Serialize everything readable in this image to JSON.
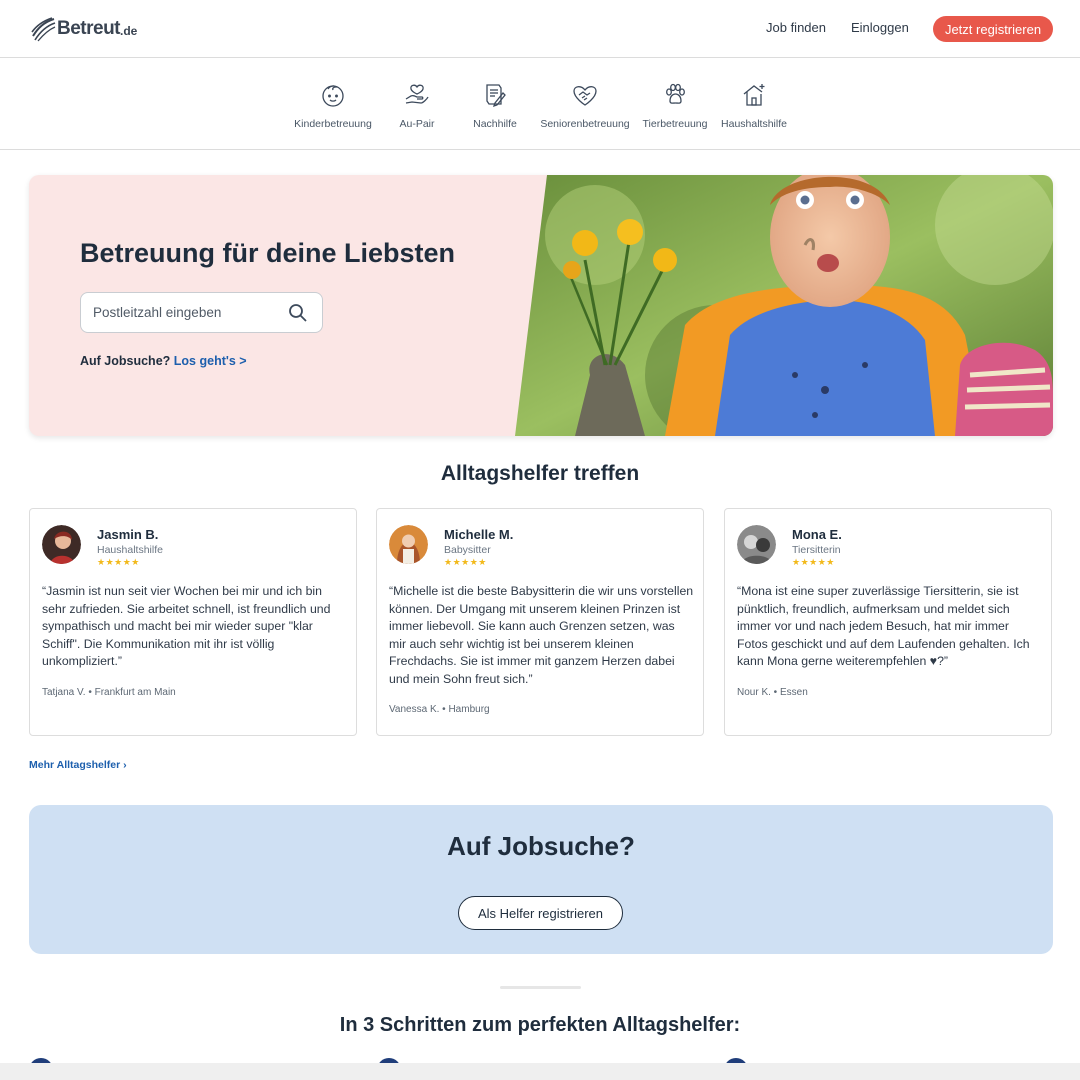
{
  "header": {
    "logo_text": "Betreut",
    "logo_tld": ".de",
    "nav": {
      "job_finden": "Job finden",
      "einloggen": "Einloggen",
      "register": "Jetzt registrieren"
    }
  },
  "categories": [
    {
      "label": "Kinderbetreuung",
      "icon": "child-face-icon"
    },
    {
      "label": "Au-Pair",
      "icon": "hand-heart-icon"
    },
    {
      "label": "Nachhilfe",
      "icon": "notebook-pencil-icon"
    },
    {
      "label": "Seniorenbetreuung",
      "icon": "handshake-heart-icon"
    },
    {
      "label": "Tierbetreuung",
      "icon": "paw-icon"
    },
    {
      "label": "Haushaltshilfe",
      "icon": "house-sparkle-icon"
    }
  ],
  "hero": {
    "title": "Betreuung für deine Liebsten",
    "search_placeholder": "Postleitzahl eingeben",
    "job_prompt": "Auf Jobsuche?",
    "job_link": "Los geht's >"
  },
  "helpers_section": {
    "title": "Alltagshelfer treffen",
    "cards": [
      {
        "name": "Jasmin B.",
        "role": "Haushaltshilfe",
        "stars": "★★★★★",
        "quote": "“Jasmin ist nun seit vier Wochen bei mir und ich bin sehr zufrieden. Sie arbeitet schnell, ist freundlich und sympathisch und macht bei mir wieder super \"klar Schiff\". Die Kommunikation mit ihr ist völlig unkompliziert.”",
        "author": "Tatjana V. • Frankfurt am Main"
      },
      {
        "name": "Michelle M.",
        "role": "Babysitter",
        "stars": "★★★★★",
        "quote": "“Michelle ist die beste Babysitterin die wir uns vorstellen können. Der Umgang mit unserem kleinen Prinzen ist immer liebevoll. Sie kann auch Grenzen setzen, was mir auch sehr wichtig ist bei unserem kleinen Frechdachs. Sie ist immer mit ganzem Herzen dabei und mein Sohn freut sich.”",
        "author": "Vanessa K. • Hamburg"
      },
      {
        "name": "Mona E.",
        "role": "Tiersitterin",
        "stars": "★★★★★",
        "quote": "“Mona ist eine super zuverlässige Tiersitterin, sie ist pünktlich, freundlich, aufmerksam und meldet sich immer vor und nach jedem Besuch, hat mir immer Fotos geschickt und auf dem Laufenden gehalten. Ich kann Mona gerne weiterempfehlen ♥?”",
        "author": "Nour K. • Essen"
      }
    ],
    "more_link": "Mehr Alltagshelfer ›"
  },
  "job_banner": {
    "title": "Auf Jobsuche?",
    "button": "Als Helfer registrieren"
  },
  "steps_section": {
    "title": "In 3 Schritten zum perfekten Alltagshelfer:"
  },
  "colors": {
    "accent": "#e8584b",
    "link": "#1d5fad",
    "hero_bg": "#fbe6e5",
    "banner_bg": "#cfe0f3",
    "star": "#f2b91b"
  }
}
